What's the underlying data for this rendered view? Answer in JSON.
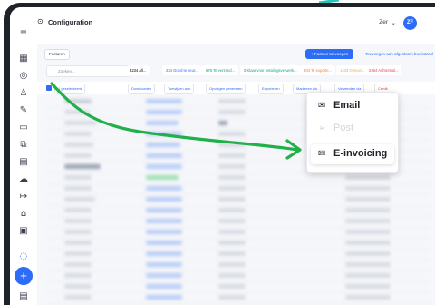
{
  "header": {
    "title": "Configuration",
    "user": "Zer",
    "avatar_initials": "ZF"
  },
  "top_actions": {
    "invoices_button": "Facturen",
    "new_invoice": "+ Factuur toevoegen",
    "bulk_link": "Toevoegen aan afgesloten boekstand"
  },
  "search": {
    "placeholder": "Zoeken..."
  },
  "filters": [
    {
      "label": "4234 All...",
      "color": "#1f2329"
    },
    {
      "label": "234 Goed te keur...",
      "color": "#2d6cf6"
    },
    {
      "label": "678 Te verzend...",
      "color": "#1aa37a"
    },
    {
      "label": "0 Klaar voor betalingsverwerk...",
      "color": "#1aa37a"
    },
    {
      "label": "904 Te exporte...",
      "color": "#e8833a"
    },
    {
      "label": "1433 Ontvan...",
      "color": "#e8b23a"
    },
    {
      "label": "2364 Achterstal...",
      "color": "#e04848"
    }
  ],
  "toolbar": {
    "selected": "1 geselecteerd",
    "download": "Downloaden",
    "assign": "Toewijzen aan",
    "generate": "Opvolgen genereren",
    "export": "Exporteren",
    "mark": "Markeren als",
    "send": "Verzenden via",
    "credit": "Credit"
  },
  "popup": {
    "items": [
      {
        "label": "Email",
        "icon": "envelope-icon",
        "enabled": true
      },
      {
        "label": "Post",
        "icon": "send-icon",
        "enabled": false
      },
      {
        "label": "E-invoicing",
        "icon": "envelope-icon",
        "enabled": true
      }
    ]
  },
  "colors": {
    "accent": "#2d6cf6",
    "arrow": "#22b04a"
  }
}
